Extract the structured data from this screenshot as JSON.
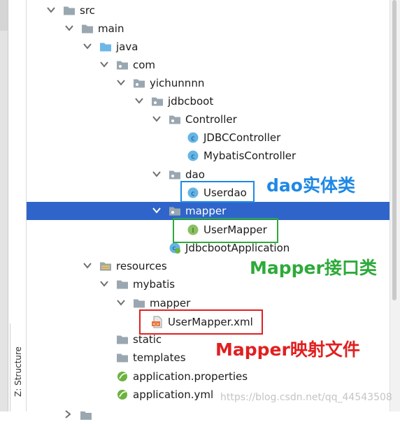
{
  "side_panel": {
    "structure_label": "Z: Structure"
  },
  "tree": {
    "items": [
      {
        "label": "src",
        "icon": "folder-icon",
        "arrow": "expanded"
      },
      {
        "label": "main",
        "icon": "folder-icon",
        "arrow": "expanded"
      },
      {
        "label": "java",
        "icon": "source-folder-icon",
        "arrow": "expanded"
      },
      {
        "label": "com",
        "icon": "package-icon",
        "arrow": "expanded"
      },
      {
        "label": "yichunnnn",
        "icon": "package-icon",
        "arrow": "expanded"
      },
      {
        "label": "jdbcboot",
        "icon": "package-icon",
        "arrow": "expanded"
      },
      {
        "label": "Controller",
        "icon": "package-icon",
        "arrow": "expanded"
      },
      {
        "label": "JDBCController",
        "icon": "class-icon",
        "arrow": "none"
      },
      {
        "label": "MybatisController",
        "icon": "class-icon",
        "arrow": "none"
      },
      {
        "label": "dao",
        "icon": "package-icon",
        "arrow": "expanded"
      },
      {
        "label": "Userdao",
        "icon": "class-icon",
        "arrow": "none"
      },
      {
        "label": "mapper",
        "icon": "package-icon",
        "arrow": "expanded",
        "selected": true
      },
      {
        "label": "UserMapper",
        "icon": "interface-icon",
        "arrow": "none"
      },
      {
        "label": "JdbcbootApplication",
        "icon": "spring-boot-app-icon",
        "arrow": "none"
      },
      {
        "label": "resources",
        "icon": "resources-folder-icon",
        "arrow": "expanded"
      },
      {
        "label": "mybatis",
        "icon": "folder-icon",
        "arrow": "expanded"
      },
      {
        "label": "mapper",
        "icon": "folder-icon",
        "arrow": "expanded"
      },
      {
        "label": "UserMapper.xml",
        "icon": "xml-file-icon",
        "arrow": "none"
      },
      {
        "label": "static",
        "icon": "folder-icon",
        "arrow": "none"
      },
      {
        "label": "templates",
        "icon": "folder-icon",
        "arrow": "none"
      },
      {
        "label": "application.properties",
        "icon": "spring-properties-icon",
        "arrow": "none"
      },
      {
        "label": "application.yml",
        "icon": "spring-yml-icon",
        "arrow": "none"
      }
    ]
  },
  "annotations": {
    "dao": {
      "text": "dao实体类",
      "color": "#1e88e5"
    },
    "mapper_interface": {
      "text": "Mapper接口类",
      "color": "#2eaa3a"
    },
    "mapper_xml": {
      "text": "Mapper映射文件",
      "color": "#e02020"
    }
  },
  "watermark": "https://blog.csdn.net/qq_44543508",
  "colors": {
    "selection": "#2f65ca",
    "folder": "#9aa7b0",
    "source_folder": "#6eb6e8",
    "class_icon": "#63b5e6",
    "interface_icon": "#8ac060"
  }
}
